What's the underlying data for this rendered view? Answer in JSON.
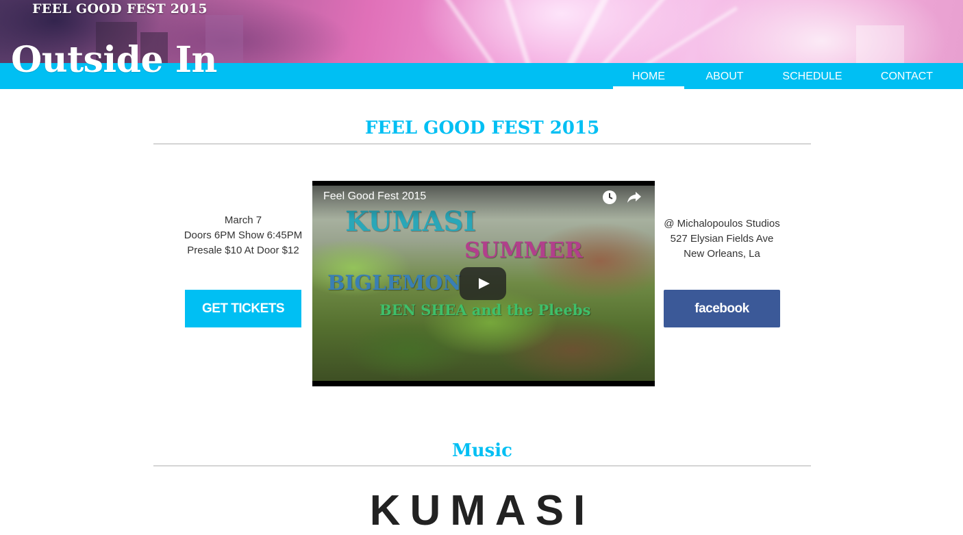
{
  "header": {
    "subtitle": "FEEL GOOD FEST 2015",
    "title": "Outside In"
  },
  "nav": {
    "items": [
      {
        "label": "HOME",
        "active": true
      },
      {
        "label": "ABOUT",
        "active": false
      },
      {
        "label": "SCHEDULE",
        "active": false
      },
      {
        "label": "CONTACT",
        "active": false
      }
    ]
  },
  "event": {
    "heading": "FEEL GOOD FEST 2015",
    "date": "March 7",
    "times": "Doors 6PM Show 6:45PM",
    "prices": "Presale $10 At Door $12",
    "venue": "@ Michalopoulos Studios",
    "address": "527 Elysian Fields Ave",
    "city": "New Orleans, La",
    "tickets_label": "GET TICKETS",
    "facebook_label": "facebook"
  },
  "video": {
    "title": "Feel Good Fest 2015",
    "overlay": {
      "kumasi": "KUMASI",
      "summer": "SUMMER",
      "biglemon": "BIGLEMON",
      "benshea": "BEN SHEA and the Pleebs"
    },
    "icons": [
      "clock-icon",
      "share-icon",
      "play-icon"
    ]
  },
  "music": {
    "heading": "Music",
    "band": "KUMASI"
  },
  "colors": {
    "accent": "#00bff3",
    "facebook": "#3b5998",
    "rule": "#d4d4d4"
  }
}
